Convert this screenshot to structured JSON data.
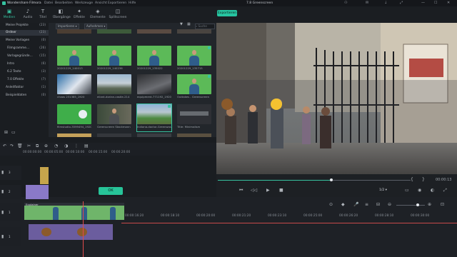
{
  "window": {
    "app_name": "Wondershare Filmora",
    "project_title": "7.8 Greenscreen",
    "menu": [
      "Datei",
      "Bearbeiten",
      "Werkzeuge",
      "Ansicht",
      "Exportieren",
      "Hilfe"
    ]
  },
  "toolbar": {
    "tabs": [
      {
        "label": "Medien",
        "icon": "media-icon"
      },
      {
        "label": "Audio",
        "icon": "audio-icon"
      },
      {
        "label": "Titel",
        "icon": "title-icon"
      },
      {
        "label": "Übergänge",
        "icon": "transition-icon"
      },
      {
        "label": "Effekte",
        "icon": "effects-icon"
      },
      {
        "label": "Elemente",
        "icon": "elements-icon"
      },
      {
        "label": "Splitscreen",
        "icon": "splitscreen-icon"
      }
    ],
    "export_label": "Exportieren",
    "accent": "#26c4a0"
  },
  "sidebar": {
    "items": [
      {
        "label": "Meine Projekte",
        "count": "(23)"
      },
      {
        "label": "Ordner",
        "count": "(23)"
      },
      {
        "label": "Meine Vorlagen",
        "count": "(0)"
      },
      {
        "label": "Filmgramme…",
        "count": "(26)"
      },
      {
        "label": "Vorlagegründe…",
        "count": "(15)"
      },
      {
        "label": "Intro",
        "count": "(6)"
      },
      {
        "label": "6.2 Texte",
        "count": "(3)"
      },
      {
        "label": "7.0 Effekte",
        "count": "(7)"
      },
      {
        "label": "Anleitfaktor",
        "count": "(1)"
      },
      {
        "label": "Beispieldaten",
        "count": "(0)"
      }
    ]
  },
  "library": {
    "import_label": "Importieren",
    "record_label": "Aufnehmen",
    "search_placeholder": "Suche",
    "thumbnails": [
      {
        "caption": "20201229_140013"
      },
      {
        "caption": "20201229_140236"
      },
      {
        "caption": "20201229_135022"
      },
      {
        "caption": "20201229_135715"
      },
      {
        "caption": "chaos 231385_1920"
      },
      {
        "caption": "eliant-dorian-castle-214"
      },
      {
        "caption": "equipment-771192_1920"
      },
      {
        "caption": "Outtakes - Greenscreen"
      },
      {
        "caption": "filmstudio-3599494_1920"
      },
      {
        "caption": "Greenscreen Stackmann"
      },
      {
        "caption": "Indiana-doctor-Greenwash"
      },
      {
        "caption": "Title: Minimalism"
      }
    ]
  },
  "playback": {
    "timecode_right": "00:00:13",
    "ratio": "1/2",
    "progress": 0.59
  },
  "timeline": {
    "ruler": [
      "00:00:00:00",
      "00:00:05:00",
      "00:00:10:00",
      "00:00:15:00",
      "00:00:20:00"
    ],
    "ruler2": [
      "00:00:16:20",
      "00:00:18:10",
      "00:00:20:00",
      "00:00:21:20",
      "00:00:23:10",
      "00:00:25:00",
      "00:00:26:20",
      "00:00:28:10",
      "00:00:30:00"
    ],
    "ok_label": "OK",
    "clip_label": "Explainer",
    "track_numbers": [
      "3",
      "2",
      "1",
      "1"
    ]
  }
}
